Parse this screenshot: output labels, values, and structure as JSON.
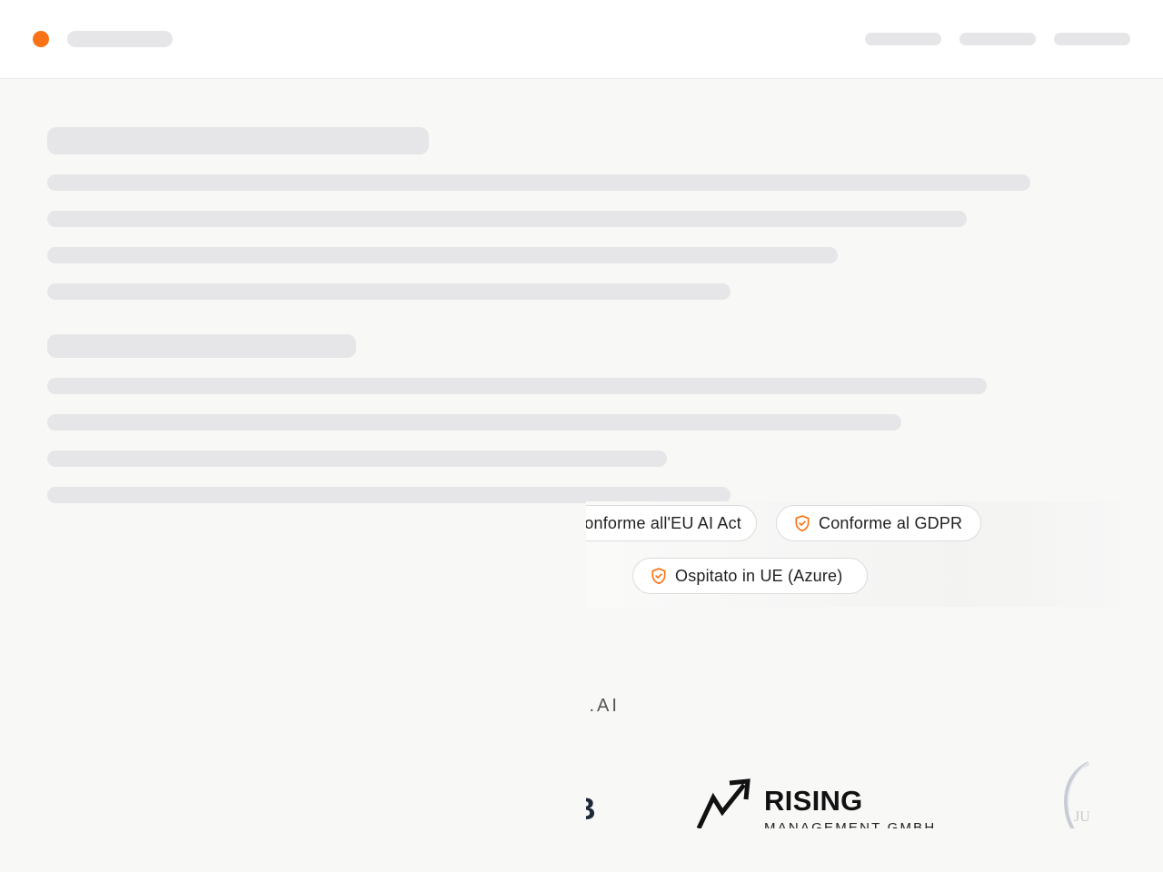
{
  "colors": {
    "accent": "#f97316",
    "skeleton": "#e6e6e8",
    "background": "#f8f8f7"
  },
  "badges": {
    "ai_act": "Conforme all'EU AI Act",
    "gdpr": "Conforme al GDPR",
    "azure": "Ospitato in UE (Azure)",
    "icon": "shield-check-icon"
  },
  "logos": {
    "ai_partial": "C.AI",
    "b_partial": "B",
    "rising_name": "RISING",
    "rising_sub": "MANAGEMENT GMBH",
    "ring_partial": "JU"
  }
}
